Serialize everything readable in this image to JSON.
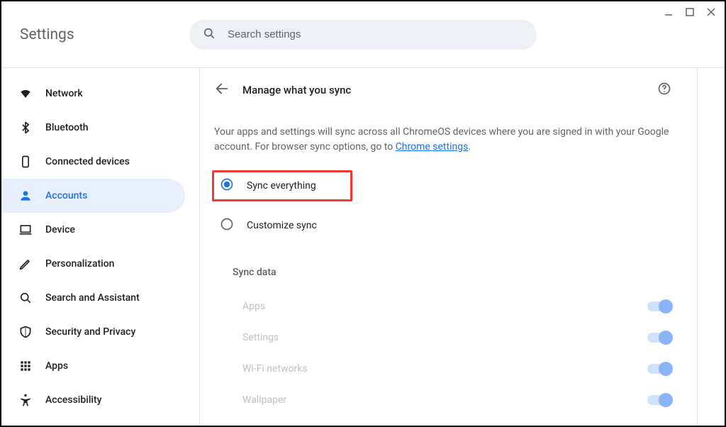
{
  "app": {
    "title": "Settings"
  },
  "search": {
    "placeholder": "Search settings"
  },
  "sidebar": {
    "items": [
      {
        "label": "Network"
      },
      {
        "label": "Bluetooth"
      },
      {
        "label": "Connected devices"
      },
      {
        "label": "Accounts"
      },
      {
        "label": "Device"
      },
      {
        "label": "Personalization"
      },
      {
        "label": "Search and Assistant"
      },
      {
        "label": "Security and Privacy"
      },
      {
        "label": "Apps"
      },
      {
        "label": "Accessibility"
      }
    ]
  },
  "page": {
    "title": "Manage what you sync",
    "description_prefix": "Your apps and settings will sync across all ChromeOS devices where you are signed in with your Google account. For browser sync options, go to ",
    "description_link": "Chrome settings",
    "description_suffix": "."
  },
  "radios": {
    "sync_everything": "Sync everything",
    "customize_sync": "Customize sync"
  },
  "sync_data": {
    "title": "Sync data",
    "items": [
      {
        "label": "Apps"
      },
      {
        "label": "Settings"
      },
      {
        "label": "Wi-Fi networks"
      },
      {
        "label": "Wallpaper"
      }
    ]
  }
}
